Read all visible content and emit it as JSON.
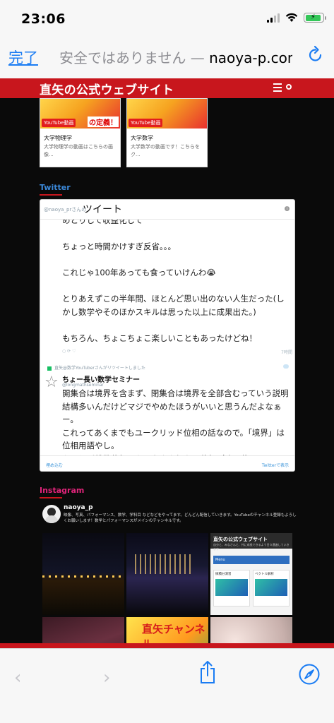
{
  "status": {
    "time": "23:06",
    "battery_glyph": "⚡",
    "battery_level": 0.9
  },
  "safari": {
    "done_label": "完了",
    "address_insecure": "安全ではありません — ",
    "address_domain": "naoya-p.com"
  },
  "site": {
    "title": "直矢の公式ウェブサイト",
    "cards": [
      {
        "badge": "YouTube動画",
        "overlay": "の定義！",
        "title": "大学物理学",
        "desc": "大学物理学の動画はこちらの画像..."
      },
      {
        "badge": "YouTube動画",
        "overlay": "",
        "title": "大学数学",
        "desc": "大学数学の動画です！こちらをク..."
      }
    ],
    "twitter_label": "Twitter",
    "instagram_label": "Instagram"
  },
  "twitter": {
    "header_user": "@naoya_prさんの",
    "header_title": "ツイート",
    "info": "i",
    "tweet1_lines": [
      "めとりして収益化して",
      "ちょっと時間かけすぎ反省。。。",
      "これじゃ100年あっても食っていけんわ😭",
      "とりあえずこの半年間、ほとんど思い出のない人生だった(しかし数学やそのほかスキルは思った以上に成果出た。)",
      "もちろん、ちょこちょこ楽しいこともあったけどね！"
    ],
    "tweet1_time": "7時間",
    "retweet_note": "直矢@数学YouTuberさんがリツイートしました",
    "rt_name": "ちょー長い数学セミナー",
    "rt_handle": "@longmathseminar",
    "rt_text": "開集合は境界を含まず、閉集合は境界を全部含むっていう説明結構多いんだけどマジでやめたほうがいいと思うんだよなぁー。\nこれってあくまでもユークリッド位相の話なので。「境界」は位相用語やし。\nたとえば離散位相みたいなやや細かい位相（強い位",
    "embed_label": "埋め込む",
    "view_label": "Twitterで表示"
  },
  "instagram": {
    "username": "naoya_p",
    "bio": "映像、写真、パフォーマンス、数学、学科目 などなどをやってます。どんどん配信していきます。YouTubeのチャンネル登録もよろしくお願いします！数学とパフォーマンスがメインのチャンネルです。",
    "site_thumb_title": "直矢の公式ウェブサイト",
    "site_thumb_sub": "自分と、みなさんと、共に成長できるよう日々邁進していきます",
    "site_thumb_menu": "Menu",
    "site_thumb_tile1": "微積分演習",
    "site_thumb_tile2": "ベクトル解析",
    "yt_thumb_text": "直矢チャンネル"
  },
  "icons": {
    "reload": "reload-icon",
    "share": "share-icon",
    "compass": "safari-compass-icon",
    "back": "back-chevron-icon",
    "forward": "forward-chevron-icon"
  },
  "colors": {
    "brand_red": "#c8161d",
    "link_blue": "#1a7cf3",
    "twitter_blue": "#3b88d8",
    "instagram_pink": "#e0247a"
  }
}
